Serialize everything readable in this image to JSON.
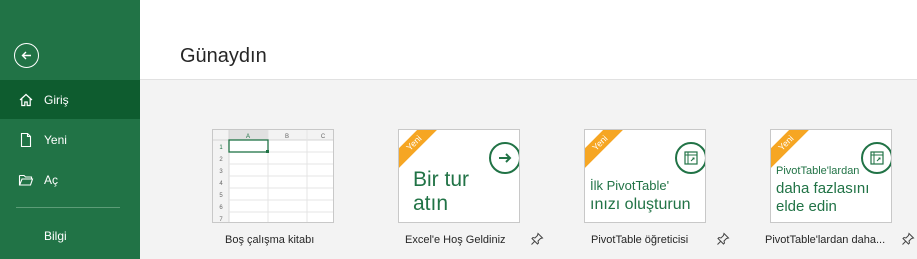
{
  "sidebar": {
    "back_label": "Geri",
    "items": [
      {
        "label": "Giriş",
        "icon": "home-icon",
        "active": true
      },
      {
        "label": "Yeni",
        "icon": "new-document-icon"
      },
      {
        "label": "Aç",
        "icon": "open-folder-icon"
      },
      {
        "label": "Bilgi"
      }
    ]
  },
  "header": {
    "title": "Günaydın"
  },
  "templates": [
    {
      "label": "Boş çalışma kitabı",
      "type": "blank",
      "grid": {
        "columns": [
          "A",
          "B",
          "C"
        ],
        "rows": [
          "1",
          "2",
          "3",
          "4",
          "5",
          "6",
          "7"
        ]
      }
    },
    {
      "label": "Excel'e Hoş Geldiniz",
      "badge": "Yeni",
      "title_line1": "Bir tur",
      "title_line2": "atın",
      "icon": "arrow-right-circle-icon"
    },
    {
      "label": "PivotTable öğreticisi",
      "badge": "Yeni",
      "title_line1": "İlk PivotTable'",
      "title_line2": "ınızı oluşturun",
      "icon": "pivot-table-icon"
    },
    {
      "label": "PivotTable'lardan daha...",
      "badge": "Yeni",
      "title_line1": "PivotTable'lardan",
      "title_line2": "daha fazlasını",
      "title_line3": "elde edin",
      "icon": "pivot-table-icon"
    }
  ],
  "colors": {
    "sidebar": "#217346",
    "active": "#0e5c2f",
    "ribbon": "#f6a623",
    "accent": "#217346"
  }
}
